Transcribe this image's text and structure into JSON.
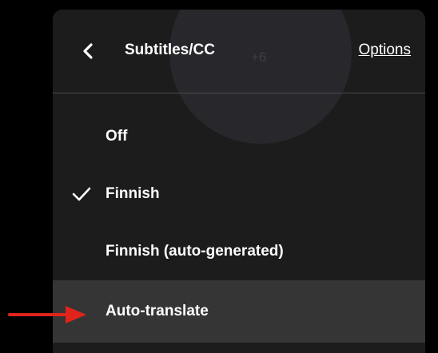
{
  "header": {
    "title": "Subtitles/CC",
    "options_label": "Options",
    "background_badge": "+6"
  },
  "menu": {
    "items": [
      {
        "label": "Off",
        "selected": false,
        "highlighted": false
      },
      {
        "label": "Finnish",
        "selected": true,
        "highlighted": false
      },
      {
        "label": "Finnish (auto-generated)",
        "selected": false,
        "highlighted": false
      },
      {
        "label": "Auto-translate",
        "selected": false,
        "highlighted": true
      }
    ]
  },
  "icons": {
    "back": "chevron-left-icon",
    "selected": "checkmark-icon",
    "annotation": "red-arrow-icon"
  },
  "colors": {
    "panel_background": "#1c1c1c",
    "highlight_row": "#353535",
    "text": "#ffffff",
    "divider": "#4a4a4a",
    "annotation_arrow": "#e0241b"
  }
}
